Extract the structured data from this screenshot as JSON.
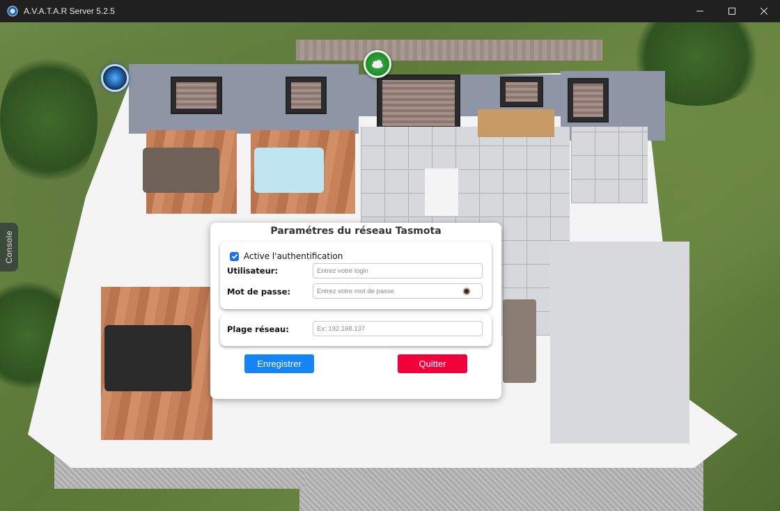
{
  "window": {
    "title": "A.V.A.T.A.R Server 5.2.5",
    "controls": [
      "minimize-icon",
      "maximize-icon",
      "close-icon"
    ]
  },
  "side_tab": {
    "label": "Console"
  },
  "dialog": {
    "title": "Paramétres du réseau Tasmota",
    "auth_checkbox": {
      "label": "Active l'authentification",
      "checked": true
    },
    "username": {
      "label": "Utilisateur:",
      "placeholder": "Entrez votre login"
    },
    "password": {
      "label": "Mot de passe:",
      "placeholder": "Entrez votre mot de passe",
      "toggle_icon": "eye-icon"
    },
    "network_range": {
      "label": "Plage réseau:",
      "placeholder": "Ex: 192.168.137"
    },
    "save_label": "Enregistrer",
    "quit_label": "Quitter"
  },
  "colors": {
    "save_button": "#1584f5",
    "quit_button": "#f2003a",
    "checkbox": "#1a73e8",
    "titlebar": "#202020"
  },
  "icons": {
    "status": "weather-cloud-icon",
    "avatar": "avatar-orb-icon",
    "app": "app-icon"
  }
}
